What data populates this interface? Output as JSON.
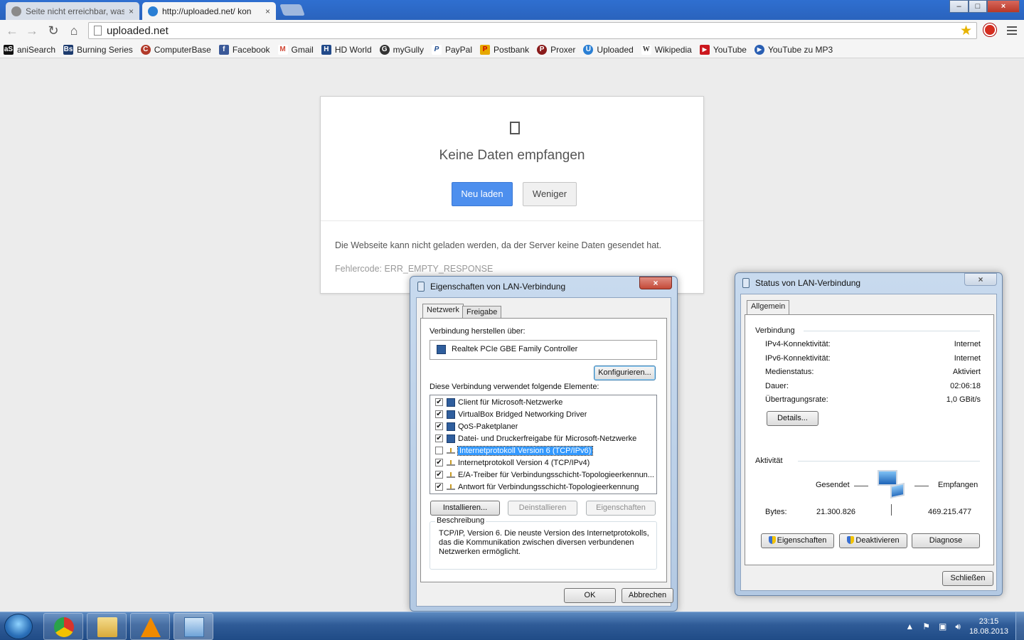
{
  "browser": {
    "tabs": [
      {
        "label": "Seite nicht erreichbar, was",
        "close": "×",
        "active": false
      },
      {
        "label": "http://uploaded.net/ kon",
        "close": "×",
        "active": true
      }
    ],
    "window_buttons": {
      "minimize": "–",
      "maximize": "□",
      "close": "×"
    },
    "address": "uploaded.net",
    "nav": {
      "back": "←",
      "forward": "→",
      "reload": "↻",
      "home": "⌂"
    },
    "bookmarks": [
      {
        "label": "aniSearch",
        "icon": "aniSearch-icon",
        "glyph": "aS",
        "color": "#111111"
      },
      {
        "label": "Burning Series",
        "icon": "burning-series-icon",
        "glyph": "Bs",
        "color": "#1d3b6e"
      },
      {
        "label": "ComputerBase",
        "icon": "computerbase-icon",
        "glyph": "C",
        "color": "#b23a2a"
      },
      {
        "label": "Facebook",
        "icon": "facebook-icon",
        "glyph": "f",
        "color": "#3b5998"
      },
      {
        "label": "Gmail",
        "icon": "gmail-icon",
        "glyph": "M",
        "color": "#d14836"
      },
      {
        "label": "HD World",
        "icon": "hd-world-icon",
        "glyph": "H",
        "color": "#224a8a"
      },
      {
        "label": "myGully",
        "icon": "mygully-icon",
        "glyph": "G",
        "color": "#333333"
      },
      {
        "label": "PayPal",
        "icon": "paypal-icon",
        "glyph": "P",
        "color": "#1e4b8e"
      },
      {
        "label": "Postbank",
        "icon": "postbank-icon",
        "glyph": "P",
        "color": "#e6a800"
      },
      {
        "label": "Proxer",
        "icon": "proxer-icon",
        "glyph": "P",
        "color": "#8a1c1c"
      },
      {
        "label": "Uploaded",
        "icon": "uploaded-icon",
        "glyph": "U",
        "color": "#2a7fd4"
      },
      {
        "label": "Wikipedia",
        "icon": "wikipedia-icon",
        "glyph": "W",
        "color": "#555555"
      },
      {
        "label": "YouTube",
        "icon": "youtube-icon",
        "glyph": "▶",
        "color": "#cc181e"
      },
      {
        "label": "YouTube zu MP3",
        "icon": "youtube-mp3-icon",
        "glyph": "▶",
        "color": "#2a5fb3"
      }
    ]
  },
  "error_page": {
    "title": "Keine Daten empfangen",
    "reload_label": "Neu laden",
    "less_label": "Weniger",
    "description": "Die Webseite kann nicht geladen werden, da der Server keine Daten gesendet hat.",
    "error_code": "Fehlercode: ERR_EMPTY_RESPONSE"
  },
  "properties_dialog": {
    "title": "Eigenschaften von LAN-Verbindung",
    "close": "×",
    "tabs": [
      "Netzwerk",
      "Freigabe"
    ],
    "connect_using_label": "Verbindung herstellen über:",
    "adapter": "Realtek PCIe GBE Family Controller",
    "configure_label": "Konfigurieren...",
    "items_label": "Diese Verbindung verwendet folgende Elemente:",
    "items": [
      {
        "label": "Client für Microsoft-Netzwerke",
        "checked": "✔",
        "icon": "network-client-icon",
        "selected": false
      },
      {
        "label": "VirtualBox Bridged Networking Driver",
        "checked": "✔",
        "icon": "network-service-icon",
        "selected": false
      },
      {
        "label": "QoS-Paketplaner",
        "checked": "✔",
        "icon": "network-service-icon",
        "selected": false
      },
      {
        "label": "Datei- und Druckerfreigabe für Microsoft-Netzwerke",
        "checked": "✔",
        "icon": "network-service-icon",
        "selected": false
      },
      {
        "label": "Internetprotokoll Version 6 (TCP/IPv6)",
        "checked": "",
        "icon": "protocol-icon",
        "selected": true
      },
      {
        "label": "Internetprotokoll Version 4 (TCP/IPv4)",
        "checked": "✔",
        "icon": "protocol-icon",
        "selected": false
      },
      {
        "label": "E/A-Treiber für Verbindungsschicht-Topologieerkennun...",
        "checked": "✔",
        "icon": "protocol-icon",
        "selected": false
      },
      {
        "label": "Antwort für Verbindungsschicht-Topologieerkennung",
        "checked": "✔",
        "icon": "protocol-icon",
        "selected": false
      }
    ],
    "install_label": "Installieren...",
    "uninstall_label": "Deinstallieren",
    "properties_label": "Eigenschaften",
    "description_header": "Beschreibung",
    "description": "TCP/IP, Version 6. Die neuste Version des Internetprotokolls, das die Kommunikation zwischen diversen verbundenen Netzwerken ermöglicht.",
    "ok_label": "OK",
    "cancel_label": "Abbrechen"
  },
  "status_dialog": {
    "title": "Status von LAN-Verbindung",
    "close": "×",
    "tab": "Allgemein",
    "connection_header": "Verbindung",
    "rows": [
      {
        "label": "IPv4-Konnektivität:",
        "value": "Internet"
      },
      {
        "label": "IPv6-Konnektivität:",
        "value": "Internet"
      },
      {
        "label": "Medienstatus:",
        "value": "Aktiviert"
      },
      {
        "label": "Dauer:",
        "value": "02:06:18"
      },
      {
        "label": "Übertragungsrate:",
        "value": "1,0 GBit/s"
      }
    ],
    "details_label": "Details...",
    "activity_header": "Aktivität",
    "sent_label": "Gesendet",
    "received_label": "Empfangen",
    "bytes_label": "Bytes:",
    "bytes_sent": "21.300.826",
    "bytes_received": "469.215.477",
    "properties_label": "Eigenschaften",
    "disable_label": "Deaktivieren",
    "diagnose_label": "Diagnose",
    "close_label": "Schließen"
  },
  "taskbar": {
    "apps": [
      {
        "name": "chrome-taskbar-button",
        "icon": "chrome-icon",
        "color": "#d9342b"
      },
      {
        "name": "explorer-taskbar-button",
        "icon": "folder-icon",
        "color": "#e8c25a"
      },
      {
        "name": "vlc-taskbar-button",
        "icon": "vlc-icon",
        "color": "#f08a00"
      },
      {
        "name": "network-taskbar-button",
        "icon": "network-connections-icon",
        "color": "#9fc4e8"
      }
    ],
    "time": "23:15",
    "date": "18.08.2013"
  }
}
